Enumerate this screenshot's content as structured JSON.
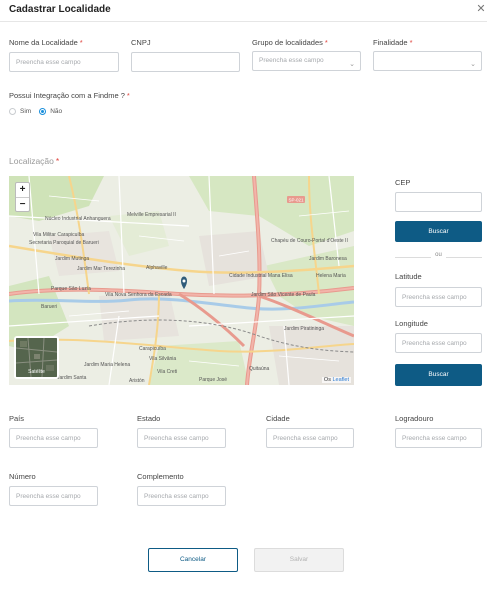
{
  "modal": {
    "title": "Cadastrar Localidade"
  },
  "fields": {
    "nome_label": "Nome da Localidade",
    "nome_placeholder": "Preencha esse campo",
    "cnpj_label": "CNPJ",
    "grupo_label": "Grupo de localidades",
    "grupo_placeholder": "Preencha esse campo",
    "finalidade_label": "Finalidade",
    "integracao_label": "Possui Integração com a Findme ?",
    "sim_label": "Sim",
    "nao_label": "Não",
    "required_mark": "*"
  },
  "location": {
    "section_title": "Localização",
    "cep_label": "CEP",
    "buscar_label": "Buscar",
    "ou_label": "ou",
    "latitude_label": "Latitude",
    "latitude_placeholder": "Preencha esse campo",
    "longitude_label": "Longitude",
    "longitude_placeholder": "Preencha esse campo"
  },
  "map": {
    "zoom_in": "+",
    "zoom_out": "−",
    "satellite_label": "Satélite",
    "attribution_os": "Os",
    "attribution_leaflet": "Leaflet",
    "places": [
      "Melville Empresarial II",
      "Núcleo Industrial Anhanguera",
      "Vila Militar Carapicuíba",
      "Secretaria Paroquial de Barueri",
      "Jardim Mutinga",
      "Chapéu de Couro-Portal d'Oeste II",
      "Jardim Baronesa",
      "Jardim Mar Terezinha",
      "Alphaville",
      "Cidade Industrial Mana Elisa",
      "Helena Maria",
      "Parque São Luzia",
      "Vila Nova Senhora da Escada",
      "Jardim São Vicente de Paula",
      "Barueri",
      "Jardim Piratininga",
      "Carapicuíba",
      "Vila Silvânia",
      "Jardim Maria Helena",
      "Vila Creti",
      "Aristón",
      "Parque José",
      "Quitaúna",
      "Jardim Santa"
    ]
  },
  "address": {
    "pais_label": "País",
    "estado_label": "Estado",
    "cidade_label": "Cidade",
    "logradouro_label": "Logradouro",
    "numero_label": "Número",
    "complemento_label": "Complemento",
    "placeholder": "Preencha esse campo"
  },
  "footer": {
    "cancel_label": "Cancelar",
    "save_label": "Salvar"
  },
  "colors": {
    "primary": "#0e5b85",
    "required": "#e0443e",
    "radio_active": "#1a8fdc"
  }
}
